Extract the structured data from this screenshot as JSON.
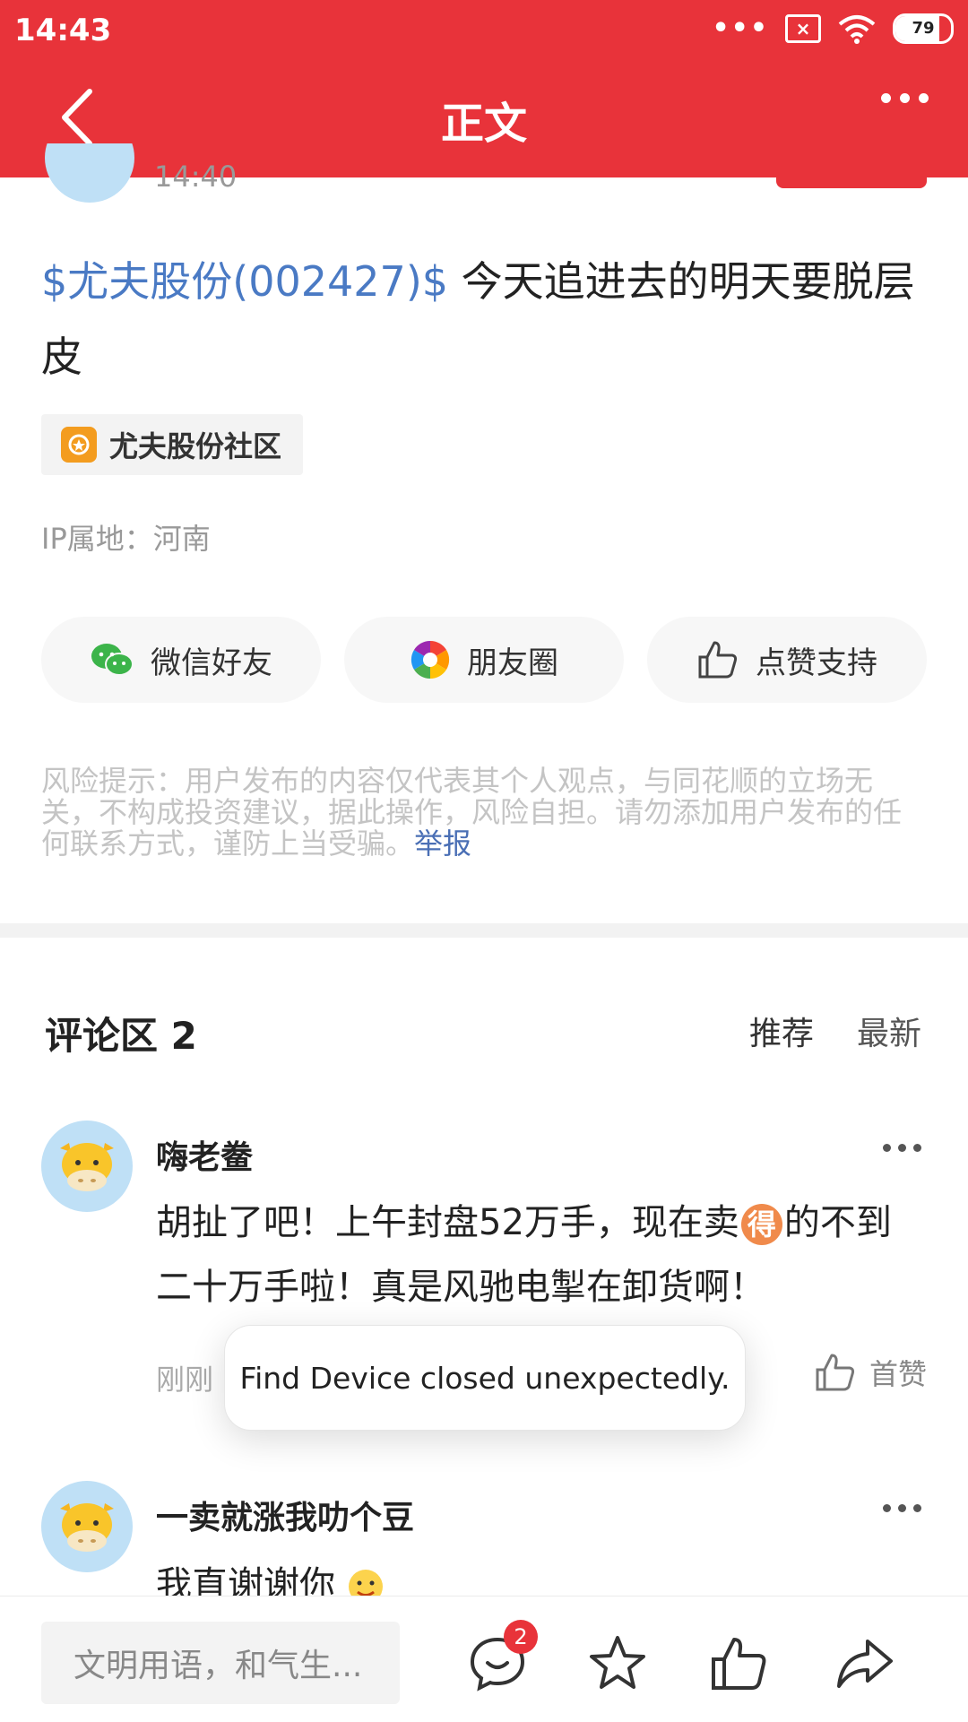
{
  "status_bar": {
    "time": "14:43",
    "battery": "79",
    "battery_fraction": 0.79
  },
  "header": {
    "title": "正文"
  },
  "post": {
    "time": "14:40",
    "stock_tag": "$尤夫股份(002427)$",
    "text": " 今天追进去的明天要脱层皮",
    "community": "尤夫股份社区",
    "ip_location": "IP属地：河南"
  },
  "share": {
    "wechat": "微信好友",
    "moments": "朋友圈",
    "like": "点赞支持"
  },
  "risk": {
    "text": "风险提示：用户发布的内容仅代表其个人观点，与同花顺的立场无关，不构成投资建议，据此操作，风险自担。请勿添加用户发布的任何联系方式，谨防上当受骗。",
    "report": "举报"
  },
  "comments": {
    "title": "评论区 2",
    "sort_recommend": "推荐",
    "sort_latest": "最新",
    "items": [
      {
        "name": "嗨老鲞",
        "text_before": "胡扯了吧！上午封盘52万手，现在卖",
        "emoji": "得",
        "text_after": "的不到二十万手啦！真是风驰电掣在卸货啊！",
        "time": "刚刚",
        "like": "首赞"
      },
      {
        "name": "一卖就涨我叻个豆",
        "text": "我直谢谢你"
      }
    ]
  },
  "toast": {
    "message": "Find Device closed unexpectedly."
  },
  "bottom": {
    "input_placeholder": "文明用语，和气生...",
    "comment_count": "2"
  }
}
